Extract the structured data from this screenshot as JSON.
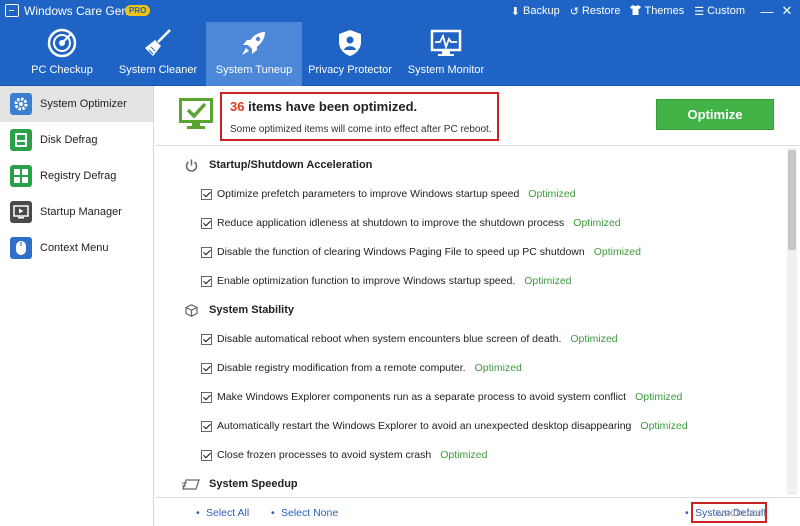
{
  "app": {
    "title": "Windows Care Genius",
    "badge": "PRO"
  },
  "top_links": [
    {
      "label": "Backup",
      "icon": "download-icon"
    },
    {
      "label": "Restore",
      "icon": "restore-icon"
    },
    {
      "label": "Themes",
      "icon": "shirt-icon"
    },
    {
      "label": "Custom",
      "icon": "list-icon"
    }
  ],
  "window_controls": {
    "minimize": "—",
    "close": "✕"
  },
  "nav_tabs": [
    {
      "label": "PC Checkup",
      "icon": "radar-icon",
      "active": false
    },
    {
      "label": "System Cleaner",
      "icon": "broom-icon",
      "active": false
    },
    {
      "label": "System Tuneup",
      "icon": "rocket-icon",
      "active": true
    },
    {
      "label": "Privacy Protector",
      "icon": "shield-icon",
      "active": false
    },
    {
      "label": "System Monitor",
      "icon": "monitor-icon",
      "active": false
    }
  ],
  "sidebar": {
    "items": [
      {
        "label": "System Optimizer",
        "icon": "gear-icon",
        "color": "#3b7fd1",
        "active": true
      },
      {
        "label": "Disk Defrag",
        "icon": "disk-icon",
        "color": "#2ba04a",
        "active": false
      },
      {
        "label": "Registry Defrag",
        "icon": "grid-icon",
        "color": "#2ba04a",
        "active": false
      },
      {
        "label": "Startup Manager",
        "icon": "startup-icon",
        "color": "#4a4a4a",
        "active": false
      },
      {
        "label": "Context Menu",
        "icon": "mouse-icon",
        "color": "#2f6fc7",
        "active": false
      }
    ]
  },
  "summary": {
    "count": "36",
    "title_rest": " items have been optimized.",
    "subtitle": "Some optimized items will come into effect after PC reboot."
  },
  "optimize_button": "Optimize",
  "sections": [
    {
      "title": "Startup/Shutdown Acceleration",
      "icon": "power-icon",
      "items": [
        {
          "label": "Optimize prefetch parameters to improve Windows startup speed",
          "status": "Optimized"
        },
        {
          "label": "Reduce application idleness at shutdown to improve the shutdown process",
          "status": "Optimized"
        },
        {
          "label": "Disable the function of clearing Windows Paging File to speed up PC shutdown",
          "status": "Optimized"
        },
        {
          "label": "Enable optimization function to improve Windows startup speed.",
          "status": "Optimized"
        }
      ]
    },
    {
      "title": "System Stability",
      "icon": "cube-icon",
      "items": [
        {
          "label": "Disable automatical reboot when system encounters blue screen of death.",
          "status": "Optimized"
        },
        {
          "label": "Disable registry modification from a remote computer.",
          "status": "Optimized"
        },
        {
          "label": "Make Windows Explorer components run as a separate process to avoid system conflict",
          "status": "Optimized"
        },
        {
          "label": "Automatically restart the Windows Explorer to avoid an unexpected desktop disappearing",
          "status": "Optimized"
        },
        {
          "label": "Close frozen processes to avoid system crash",
          "status": "Optimized"
        }
      ]
    },
    {
      "title": "System Speedup",
      "icon": "speed-icon",
      "items": []
    }
  ],
  "footer": {
    "select_all": "Select All",
    "select_none": "Select None",
    "system_default": "System Default"
  },
  "watermark": "wsxdn.com",
  "colors": {
    "header_blue": "#1f63c4",
    "active_tab": "#4d88d8",
    "optimize_green": "#41b347",
    "status_green": "#3d9a3d",
    "highlight_red": "#cc2222",
    "count_red": "#e03a24"
  }
}
